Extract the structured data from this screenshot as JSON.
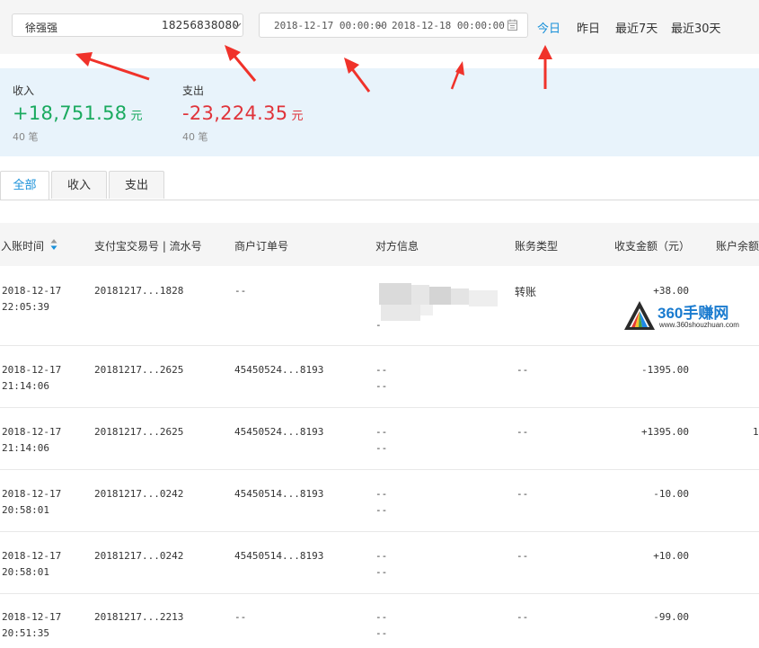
{
  "filter": {
    "account_name": "徐强强",
    "account_phone": "18256838080",
    "date_start": "2018-12-17 00:00:00",
    "date_sep": "~",
    "date_end": "2018-12-18 00:00:00",
    "quick_ranges": [
      "今日",
      "昨日",
      "最近7天",
      "最近30天"
    ],
    "active_color": "#1890d9"
  },
  "summary": {
    "income_label": "收入",
    "income_value": "+18,751.58",
    "income_unit": "元",
    "income_count": "40 笔",
    "expense_label": "支出",
    "expense_value": "-23,224.35",
    "expense_unit": "元",
    "expense_count": "40 笔",
    "income_color": "#1aaa5f",
    "expense_color": "#e0333a"
  },
  "tabs": [
    "全部",
    "收入",
    "支出"
  ],
  "table": {
    "headers": {
      "time": "入账时间",
      "trade_no": "支付宝交易号 | 流水号",
      "order_no": "商户订单号",
      "counterparty": "对方信息",
      "type": "账务类型",
      "amount": "收支金额（元）",
      "balance": "账户余额"
    },
    "rows": [
      {
        "date": "2018-12-17",
        "time": "22:05:39",
        "trade_no": "20181217...1828",
        "order_no": "--",
        "party1": "",
        "party2": "-",
        "type": "转账",
        "amount": "+38.00",
        "balance": ""
      },
      {
        "date": "2018-12-17",
        "time": "21:14:06",
        "trade_no": "20181217...2625",
        "order_no": "45450524...8193",
        "party1": "--",
        "party2": "--",
        "type": "--",
        "amount": "-1395.00",
        "balance": ""
      },
      {
        "date": "2018-12-17",
        "time": "21:14:06",
        "trade_no": "20181217...2625",
        "order_no": "45450524...8193",
        "party1": "--",
        "party2": "--",
        "type": "--",
        "amount": "+1395.00",
        "balance": "1"
      },
      {
        "date": "2018-12-17",
        "time": "20:58:01",
        "trade_no": "20181217...0242",
        "order_no": "45450514...8193",
        "party1": "--",
        "party2": "--",
        "type": "--",
        "amount": "-10.00",
        "balance": ""
      },
      {
        "date": "2018-12-17",
        "time": "20:58:01",
        "trade_no": "20181217...0242",
        "order_no": "45450514...8193",
        "party1": "--",
        "party2": "--",
        "type": "--",
        "amount": "+10.00",
        "balance": ""
      },
      {
        "date": "2018-12-17",
        "time": "20:51:35",
        "trade_no": "20181217...2213",
        "order_no": "--",
        "party1": "--",
        "party2": "--",
        "type": "--",
        "amount": "-99.00",
        "balance": ""
      }
    ]
  },
  "watermark": {
    "text": "360手赚网",
    "url": "www.360shouzhuan.com"
  },
  "annotation_arrow_color": "#f0322a"
}
